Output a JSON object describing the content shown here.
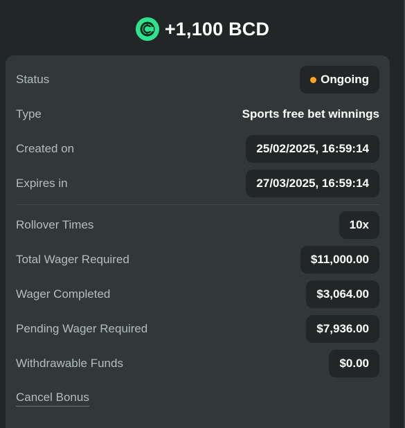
{
  "header": {
    "amount": "+1,100 BCD",
    "coin_icon": "bcd-coin-icon",
    "coin_color": "#2ee28e"
  },
  "details": {
    "status_label": "Status",
    "status_value": "Ongoing",
    "status_color": "#ffa31a",
    "type_label": "Type",
    "type_value": "Sports free bet winnings",
    "created_label": "Created on",
    "created_value": "25/02/2025, 16:59:14",
    "expires_label": "Expires in",
    "expires_value": "27/03/2025, 16:59:14",
    "rollover_label": "Rollover Times",
    "rollover_value": "10x",
    "total_wager_label": "Total Wager Required",
    "total_wager_value": "$11,000.00",
    "wager_completed_label": "Wager Completed",
    "wager_completed_value": "$3,064.00",
    "pending_wager_label": "Pending Wager Required",
    "pending_wager_value": "$7,936.00",
    "withdrawable_label": "Withdrawable Funds",
    "withdrawable_value": "$0.00"
  },
  "actions": {
    "cancel_label": "Cancel Bonus"
  }
}
